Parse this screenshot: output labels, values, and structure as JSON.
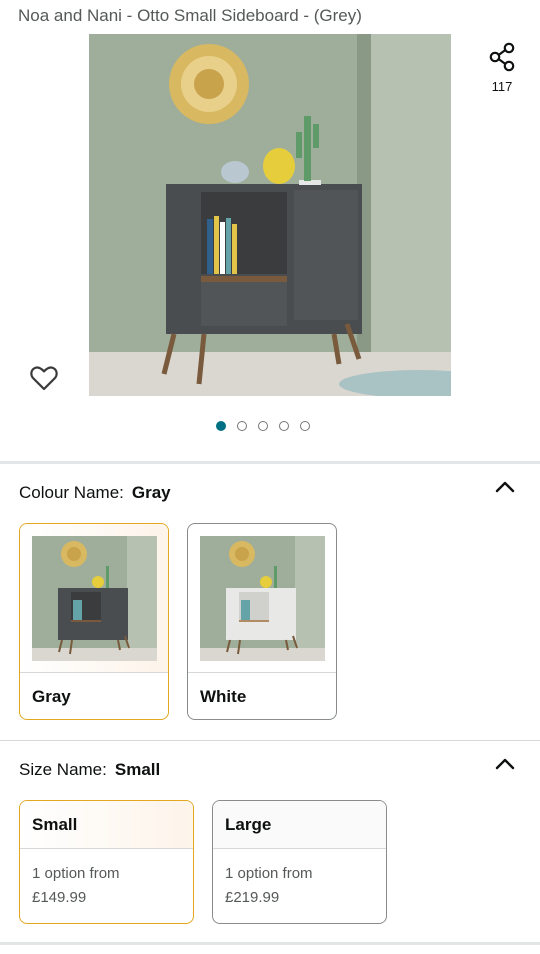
{
  "product": {
    "title": "Noa and Nani - Otto Small Sideboard - (Grey)",
    "share_count": "117",
    "image_icon": "sideboard-product-photo"
  },
  "carousel": {
    "total": 5,
    "active": 1
  },
  "colour": {
    "label": "Colour Name:",
    "selected": "Gray",
    "options": [
      {
        "label": "Gray",
        "selected": true
      },
      {
        "label": "White",
        "selected": false
      }
    ]
  },
  "size": {
    "label": "Size Name:",
    "selected": "Small",
    "options": [
      {
        "label": "Small",
        "line1": "1 option from",
        "price": "£149.99",
        "selected": true
      },
      {
        "label": "Large",
        "line1": "1 option from",
        "price": "£219.99",
        "selected": false
      }
    ]
  },
  "colors": {
    "accent": "#007185",
    "selected_border": "#e3a722",
    "cabinet_grey": "#4a4d4f",
    "cabinet_white": "#e8e8e6",
    "wall_green": "#9fae9b"
  }
}
